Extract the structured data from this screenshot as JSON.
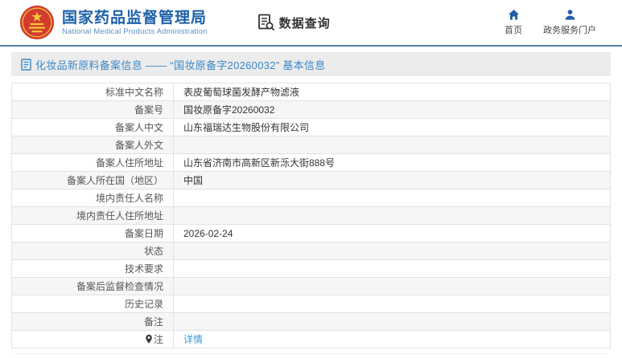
{
  "header": {
    "agency_title": "国家药品监督管理局",
    "agency_subtitle": "National Medical Products Administration",
    "data_query_label": "数据查询",
    "nav": [
      {
        "icon": "home-icon",
        "label": "首页"
      },
      {
        "icon": "user-icon",
        "label": "政务服务门户"
      }
    ]
  },
  "breadcrumb": {
    "text": "化妆品新原料备案信息 —— “国妆原备字20260032” 基本信息"
  },
  "table": {
    "rows": [
      {
        "label": "标准中文名称",
        "value": "表皮葡萄球菌发酵产物滤液"
      },
      {
        "label": "备案号",
        "value": "国妆原备字20260032"
      },
      {
        "label": "备案人中文",
        "value": "山东福瑞达生物股份有限公司"
      },
      {
        "label": "备案人外文",
        "value": ""
      },
      {
        "label": "备案人住所地址",
        "value": "山东省济南市高新区新泺大街888号"
      },
      {
        "label": "备案人所在国（地区）",
        "value": "中国"
      },
      {
        "label": "境内责任人名称",
        "value": ""
      },
      {
        "label": "境内责任人住所地址",
        "value": ""
      },
      {
        "label": "备案日期",
        "value": "2026-02-24"
      },
      {
        "label": "状态",
        "value": ""
      },
      {
        "label": "技术要求",
        "value": ""
      },
      {
        "label": "备案后监督检查情况",
        "value": ""
      },
      {
        "label": "历史记录",
        "value": ""
      },
      {
        "label": "备注",
        "value": ""
      },
      {
        "label": "注",
        "value": "详情"
      }
    ]
  },
  "colors": {
    "title_blue": "#1c61a9",
    "subtitle_blue": "#5c8fc4",
    "header_line": "#4d80ab",
    "breadcrumb_text": "#3a87c8",
    "breadcrumb_bg": "#ececec",
    "link_blue": "#3e9bd5",
    "emblem_red": "#d23b2e",
    "emblem_gold": "#f5c53a",
    "nav_icon_blue": "#2160a8"
  }
}
